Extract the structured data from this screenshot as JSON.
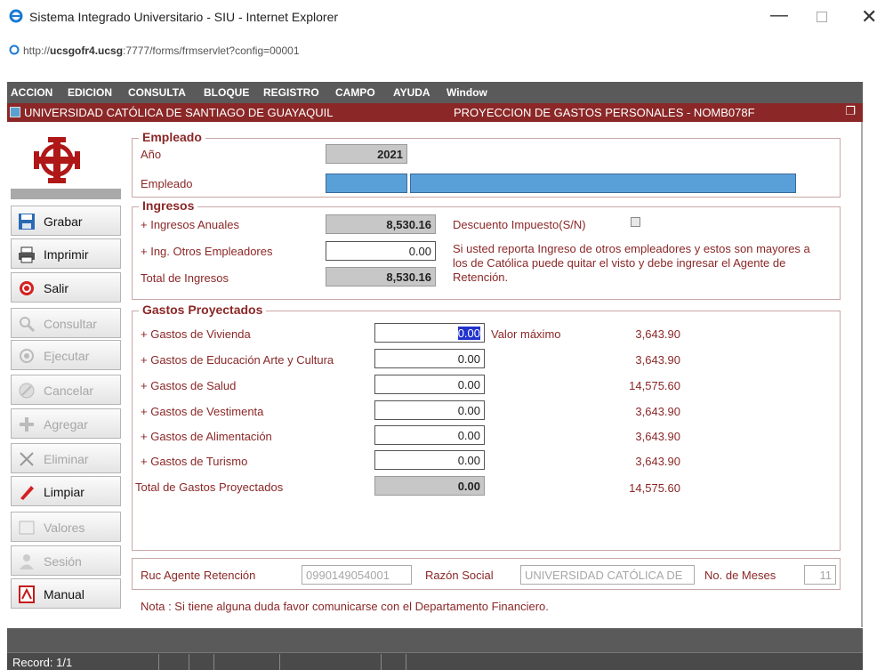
{
  "window": {
    "title": "Sistema Integrado Universitario - SIU - Internet Explorer",
    "url_prefix": "http://",
    "url_host": "ucsgofr4.ucsg",
    "url_rest": ":7777/forms/frmservlet?config=00001"
  },
  "menu": [
    "ACCION",
    "EDICION",
    "CONSULTA",
    "BLOQUE",
    "REGISTRO",
    "CAMPO",
    "AYUDA",
    "Window"
  ],
  "form_header": {
    "left": "UNIVERSIDAD CATÓLICA DE SANTIAGO DE GUAYAQUIL",
    "right": "PROYECCION DE GASTOS PERSONALES - NOMB078F"
  },
  "toolbar": {
    "grabar": "Grabar",
    "imprimir": "Imprimir",
    "salir": "Salir",
    "consultar": "Consultar",
    "ejecutar": "Ejecutar",
    "cancelar": "Cancelar",
    "agregar": "Agregar",
    "eliminar": "Eliminar",
    "limpiar": "Limpiar",
    "valores": "Valores",
    "sesion": "Sesión",
    "manual": "Manual"
  },
  "empleado": {
    "group_title": "Empleado",
    "anio_label": "Año",
    "anio_value": "2021",
    "empleado_label": "Empleado"
  },
  "ingresos": {
    "group_title": "Ingresos",
    "anuales_label": "+ Ingresos Anuales",
    "anuales_value": "8,530.16",
    "otros_label": "+ Ing. Otros Empleadores",
    "otros_value": "0.00",
    "total_label": "Total de Ingresos",
    "total_value": "8,530.16",
    "descuento_label": "Descuento Impuesto(S/N)",
    "nota": "Si usted reporta Ingreso de otros empleadores y estos son mayores a los de Católica puede quitar el visto y debe ingresar el Agente de Retención."
  },
  "gastos": {
    "group_title": "Gastos Proyectados",
    "max_header": "Valor máximo",
    "items": [
      {
        "label": "+ Gastos de Vivienda",
        "value": "0.00",
        "max": "3,643.90"
      },
      {
        "label": "+ Gastos de Educación Arte y Cultura",
        "value": "0.00",
        "max": "3,643.90"
      },
      {
        "label": "+ Gastos de Salud",
        "value": "0.00",
        "max": "14,575.60"
      },
      {
        "label": "+ Gastos de Vestimenta",
        "value": "0.00",
        "max": "3,643.90"
      },
      {
        "label": "+ Gastos de Alimentación",
        "value": "0.00",
        "max": "3,643.90"
      },
      {
        "label": "+ Gastos de Turismo",
        "value": "0.00",
        "max": "3,643.90"
      }
    ],
    "total_label": "Total de Gastos Proyectados",
    "total_value": "0.00",
    "total_max": "14,575.60"
  },
  "agente": {
    "ruc_label": "Ruc Agente Retención",
    "ruc_value": "0990149054001",
    "razon_label": "Razón Social",
    "razon_value": "UNIVERSIDAD CATÓLICA DE",
    "meses_label": "No. de Meses",
    "meses_value": "11"
  },
  "nota_final": "Nota : Si tiene alguna duda favor comunicarse con el Departamento Financiero.",
  "status": {
    "record": "Record: 1/1"
  },
  "colors": {
    "accent": "#8b2727",
    "menubar": "#5a5a5a",
    "field_blue": "#5aa0d8"
  }
}
